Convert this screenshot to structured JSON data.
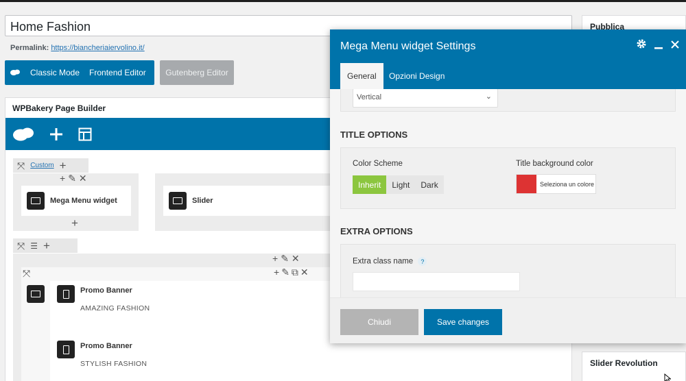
{
  "post": {
    "title": "Home Fashion",
    "permalink_label": "Permalink:",
    "permalink_url": "https://biancheriaiervolino.it/"
  },
  "mode_buttons": {
    "classic": "Classic Mode",
    "frontend": "Frontend Editor",
    "gutenberg": "Gutenberg Editor"
  },
  "builder": {
    "title": "WPBakery Page Builder",
    "row1": {
      "custom_label": "Custom",
      "elements": [
        "Mega Menu widget",
        "Slider"
      ]
    },
    "row2": {
      "promos": [
        {
          "title": "Promo Banner",
          "subtitle": "AMAZING FASHION"
        },
        {
          "title": "Promo Banner",
          "subtitle": "STYLISH FASHION"
        }
      ]
    }
  },
  "sidebar": {
    "publish": "Pubblica",
    "slider": "Slider Revolution"
  },
  "modal": {
    "title": "Mega Menu widget Settings",
    "tabs": [
      "General",
      "Opzioni Design"
    ],
    "active_tab": "General",
    "orientation_value": "Vertical",
    "title_options": {
      "heading": "TITLE OPTIONS",
      "color_scheme_label": "Color Scheme",
      "schemes": [
        "Inherit",
        "Light",
        "Dark"
      ],
      "selected_scheme": "Inherit",
      "bg_label": "Title background color",
      "bg_placeholder": "Seleziona un colore",
      "bg_color": "#dd3333"
    },
    "extra_options": {
      "heading": "EXTRA OPTIONS",
      "class_label": "Extra class name",
      "help": "?",
      "class_value": ""
    },
    "buttons": {
      "close": "Chiudi",
      "save": "Save changes"
    }
  },
  "colors": {
    "accent": "#0073aa",
    "active_segment": "#8cc63f"
  }
}
